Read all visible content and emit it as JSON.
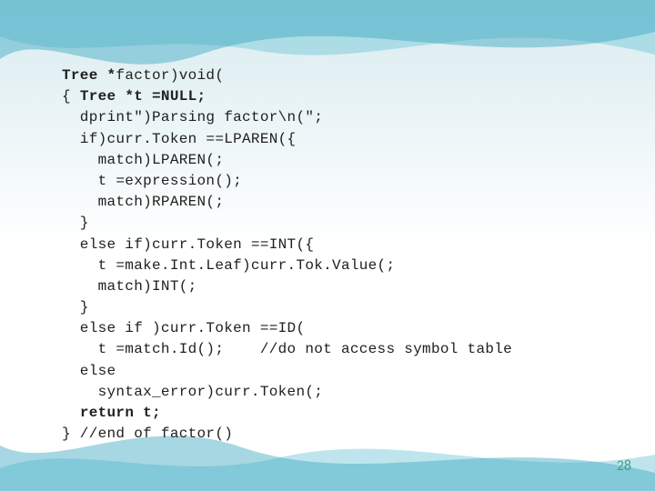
{
  "page_number": "28",
  "code": {
    "l01a": "Tree *",
    "l01b": "factor)void(",
    "l02a": "{ ",
    "l02b": "Tree *t =NULL;",
    "l03": "  dprint\")Parsing factor\\n(\";",
    "l04": "  if)curr.Token ==LPAREN({",
    "l05": "    match)LPAREN(;",
    "l06": "    t =expression();",
    "l07": "    match)RPAREN(;",
    "l08": "  }",
    "l09": "  else if)curr.Token ==INT({",
    "l10": "    t =make.Int.Leaf)curr.Tok.Value(;",
    "l11": "    match)INT(;",
    "l12": "  }",
    "l13": "  else if )curr.Token ==ID(",
    "l14": "    t =match.Id();    //do not access symbol table",
    "l15": "  else",
    "l16": "    syntax_error)curr.Token(;",
    "l17a": "  ",
    "l17b": "return t;",
    "l18": "} //end of factor()"
  }
}
